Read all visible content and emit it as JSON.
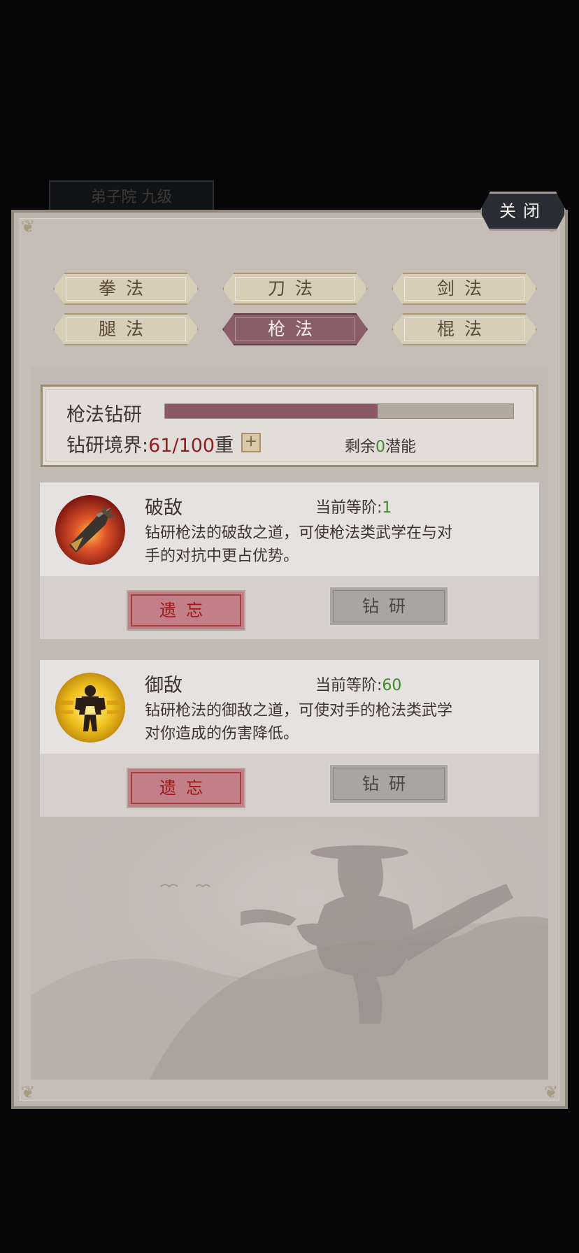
{
  "background": {
    "title": "",
    "tag": "弟子院 九级"
  },
  "close_button": {
    "label": "关闭"
  },
  "tabs": [
    {
      "label": "拳法",
      "active": false
    },
    {
      "label": "刀法",
      "active": false
    },
    {
      "label": "剑法",
      "active": false
    },
    {
      "label": "腿法",
      "active": false
    },
    {
      "label": "枪法",
      "active": true
    },
    {
      "label": "棍法",
      "active": false
    }
  ],
  "progress": {
    "title": "枪法钻研",
    "fill_fraction": 0.61,
    "realm_label": "钻研境界:",
    "realm_value": "61/100",
    "realm_suffix": "重",
    "plus_label": "+",
    "remain_prefix": "剩余",
    "remain_value": "0",
    "remain_suffix": "潜能"
  },
  "skills": [
    {
      "name": "破敌",
      "icon": "spear-strike-icon",
      "level_label": "当前等阶:",
      "level_value": "1",
      "desc_line1": "钻研枪法的破敌之道，可使枪法类武学在与对",
      "desc_line2": "手的对抗中更占优势。",
      "forget_label": "遗忘",
      "study_label": "钻研"
    },
    {
      "name": "御敌",
      "icon": "guard-warrior-icon",
      "level_label": "当前等阶:",
      "level_value": "60",
      "desc_line1": "钻研枪法的御敌之道，可使对手的枪法类武学",
      "desc_line2": "对你造成的伤害降低。",
      "forget_label": "遗忘",
      "study_label": "钻研"
    }
  ],
  "colors": {
    "accent_red": "#8e1f1f",
    "accent_green": "#3f8a2b",
    "active_tab": "#8a5e66",
    "progress_fill": "#8c5a64"
  }
}
